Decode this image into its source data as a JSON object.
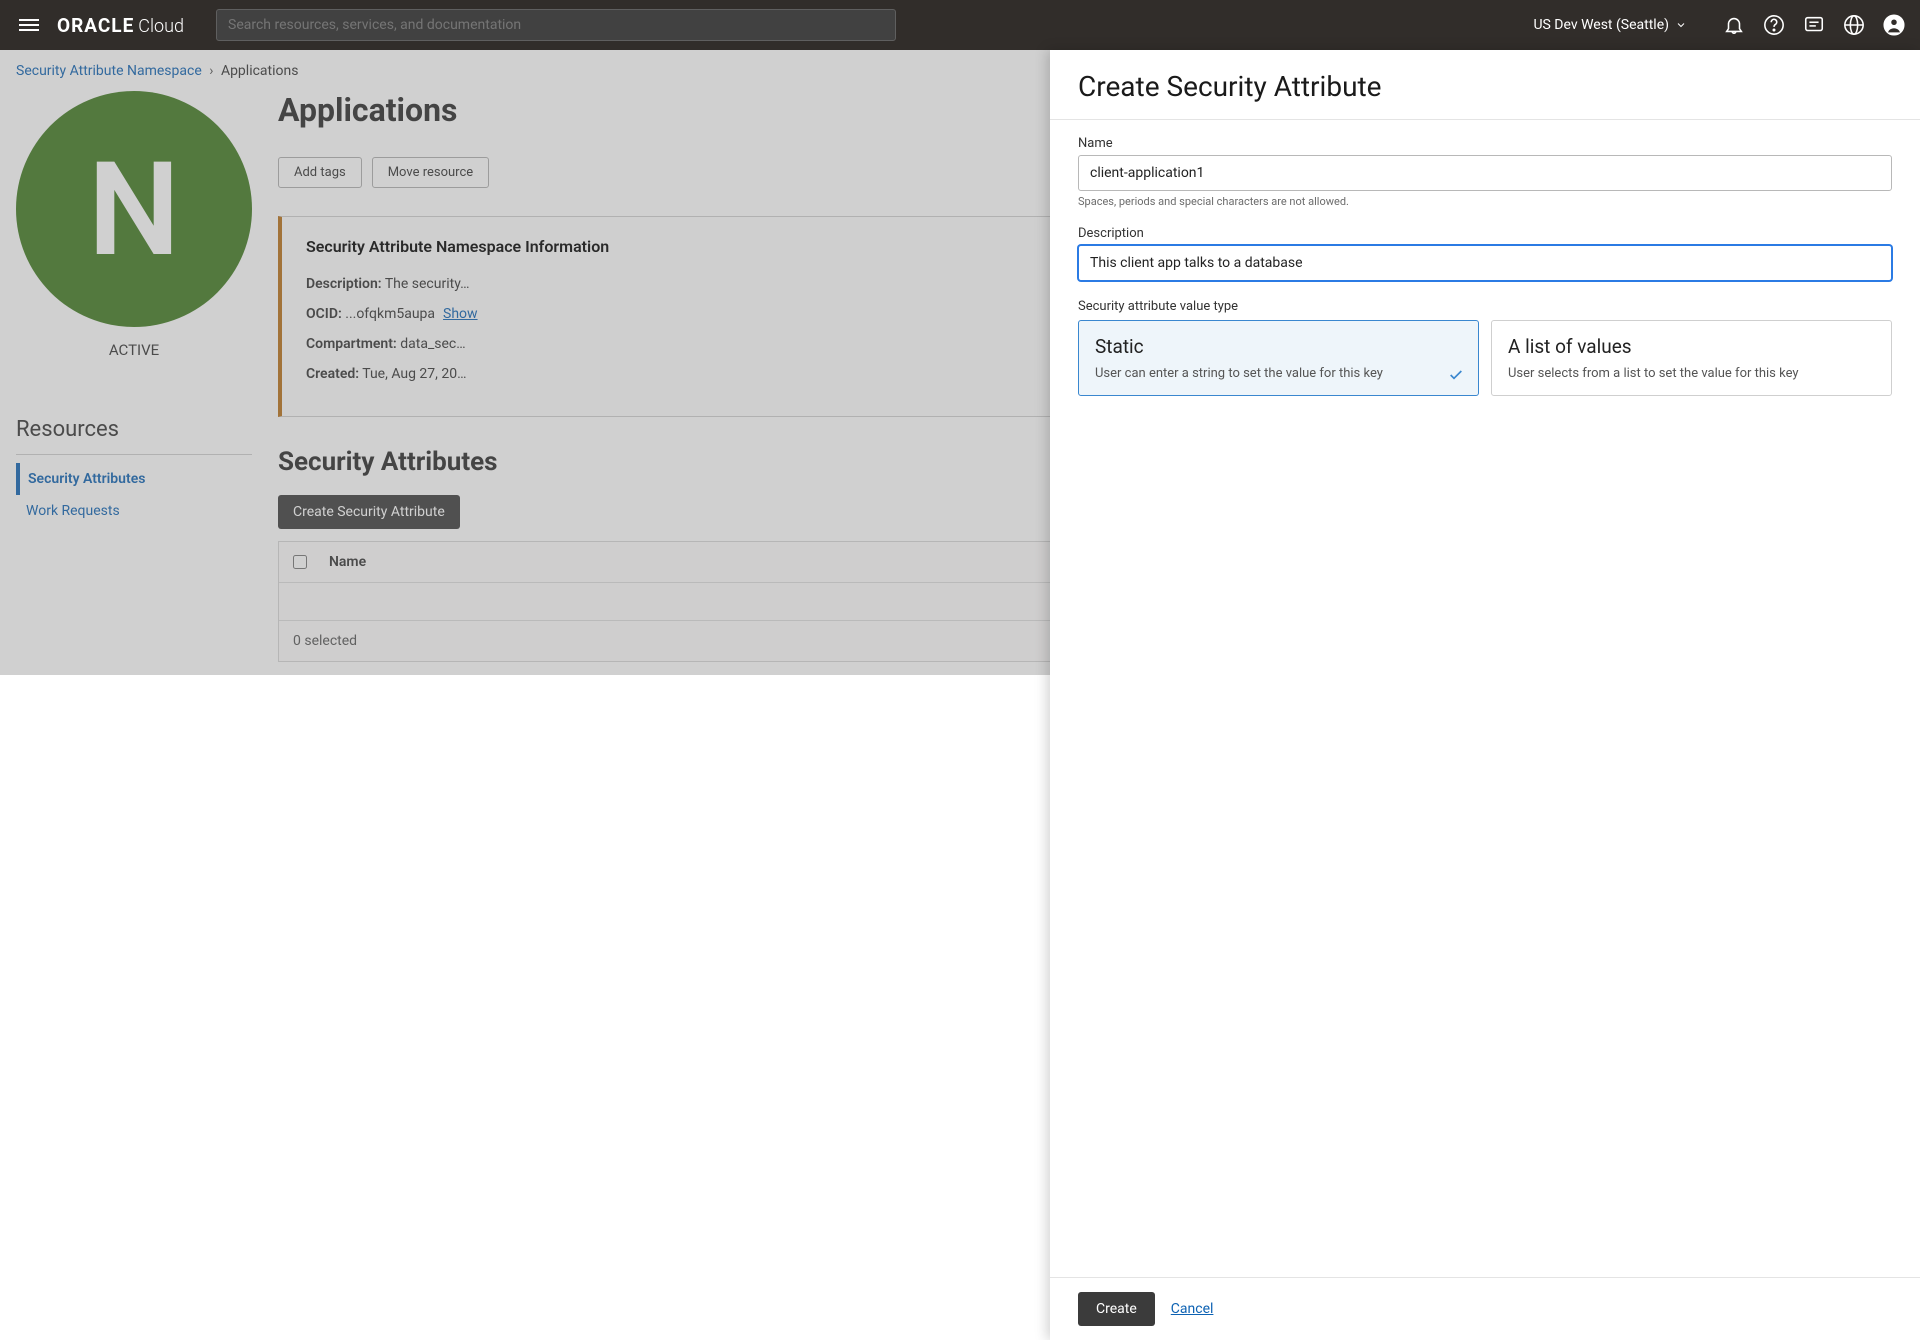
{
  "header": {
    "brand_bold": "ORACLE",
    "brand_cloud": "Cloud",
    "search_placeholder": "Search resources, services, and documentation",
    "region": "US Dev West (Seattle)"
  },
  "breadcrumb": {
    "parent": "Security Attribute Namespace",
    "current": "Applications"
  },
  "avatar": {
    "letter": "N",
    "status": "ACTIVE"
  },
  "page": {
    "title": "Applications",
    "add_tags": "Add tags",
    "move_resource": "Move resource"
  },
  "detail": {
    "heading": "Security Attribute Namespace Information",
    "description_label": "Description:",
    "description_value": "The security…",
    "ocid_label": "OCID:",
    "ocid_value": "...ofqkm5aupa",
    "ocid_show": "Show",
    "compartment_label": "Compartment:",
    "compartment_value": "data_sec…",
    "created_label": "Created:",
    "created_value": "Tue, Aug 27, 20…"
  },
  "resources": {
    "title": "Resources",
    "items": [
      "Security Attributes",
      "Work Requests"
    ]
  },
  "attributes": {
    "section_title": "Security Attributes",
    "create_button": "Create Security Attribute",
    "col_name": "Name",
    "selected_text": "0 selected"
  },
  "panel": {
    "title": "Create Security Attribute",
    "name_label": "Name",
    "name_value": "client-application1",
    "name_help": "Spaces, periods and special characters are not allowed.",
    "desc_label": "Description",
    "desc_value": "This client app talks to a database",
    "type_label": "Security attribute value type",
    "type_options": [
      {
        "title": "Static",
        "desc": "User can enter a string to set the value for this key"
      },
      {
        "title": "A list of values",
        "desc": "User selects from a list to set the value for this key"
      }
    ],
    "create": "Create",
    "cancel": "Cancel"
  }
}
